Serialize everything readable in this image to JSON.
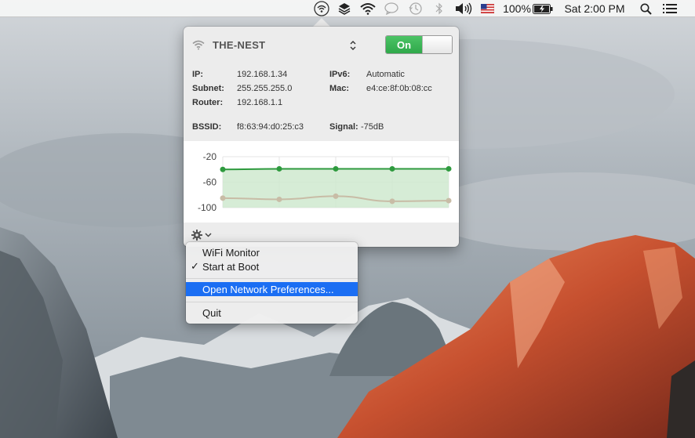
{
  "menubar": {
    "battery_percent": "100%",
    "clock": "Sat 2:00 PM",
    "icons": [
      "wifi-monitor-icon",
      "layers-icon",
      "wifi-icon",
      "speech-bubble-icon",
      "time-machine-icon",
      "bluetooth-icon",
      "volume-icon",
      "flag-icon",
      "battery-icon",
      "search-icon",
      "list-icon"
    ]
  },
  "network": {
    "name": "THE-NEST",
    "toggle_label": "On",
    "details": {
      "ip_label": "IP:",
      "ip": "192.168.1.34",
      "ipv6_label": "IPv6:",
      "ipv6": "Automatic",
      "subnet_label": "Subnet:",
      "subnet": "255.255.255.0",
      "mac_label": "Mac:",
      "mac": "e4:ce:8f:0b:08:cc",
      "router_label": "Router:",
      "router": "192.168.1.1",
      "bssid_label": "BSSID:",
      "bssid": "f8:63:94:d0:25:c3",
      "signal_label": "Signal:",
      "signal": "-75dB"
    }
  },
  "chart_data": {
    "type": "area",
    "x": [
      1,
      2,
      3,
      4,
      5
    ],
    "ylim": [
      -100,
      -20
    ],
    "yticks": [
      "-20",
      "-60",
      "-100"
    ],
    "series": [
      {
        "values": [
          -40,
          -39,
          -39,
          -39,
          -39
        ],
        "color": "#2e9a3e"
      },
      {
        "values": [
          -85,
          -87,
          -82,
          -90,
          -89
        ],
        "color": "#c8bca6"
      }
    ],
    "grid": true
  },
  "menu": {
    "items": [
      {
        "label": "WiFi Monitor",
        "checked": false
      },
      {
        "label": "Start at Boot",
        "checked": true
      },
      {
        "label": "Open Network Preferences...",
        "highlighted": true
      },
      {
        "label": "Quit"
      }
    ],
    "check_glyph": "✓"
  }
}
